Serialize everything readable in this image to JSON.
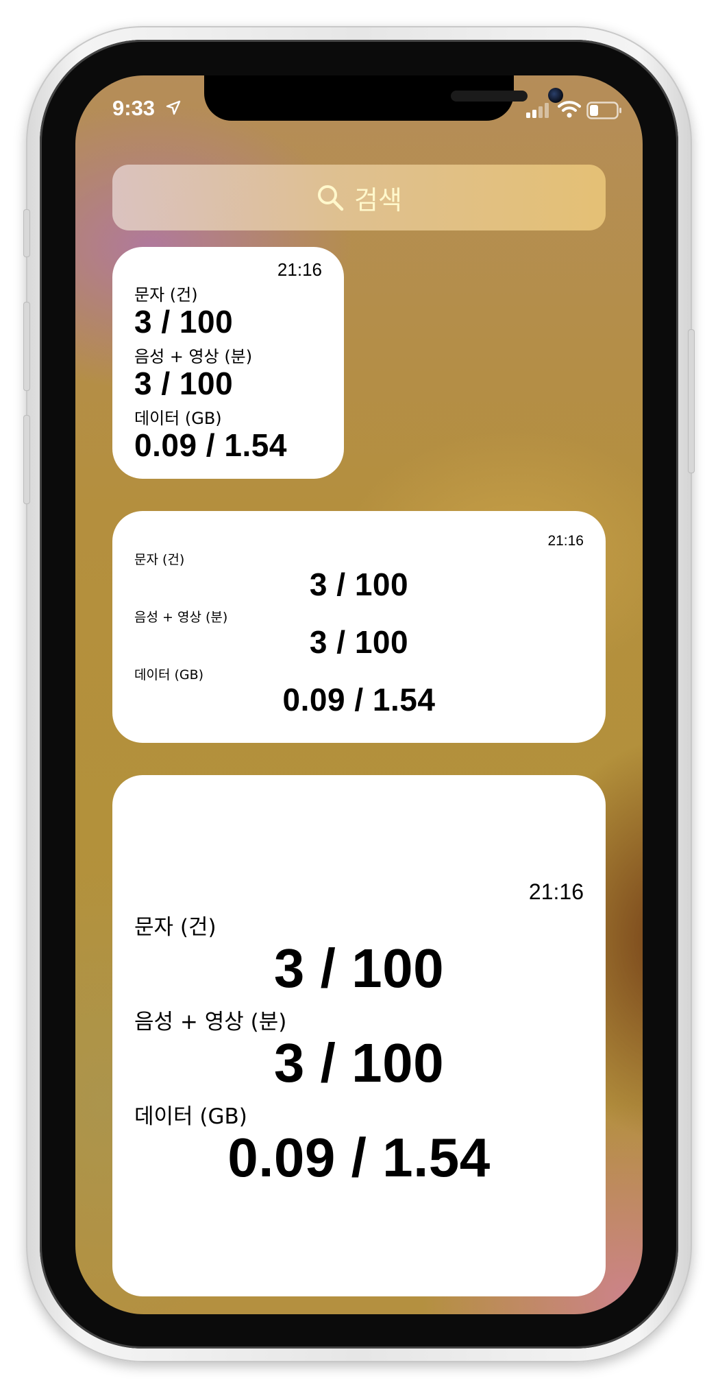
{
  "status_bar": {
    "time": "9:33",
    "icons": [
      "location-arrow-icon",
      "cellular-signal-icon",
      "wifi-icon",
      "battery-icon"
    ]
  },
  "search": {
    "label": "검색",
    "icon": "search-icon"
  },
  "widget_small": {
    "updated": "21:16",
    "sms_label": "문자 (건)",
    "sms_value": "3 / 100",
    "voice_label": "음성 + 영상 (분)",
    "voice_value": "3 / 100",
    "data_label": "데이터 (GB)",
    "data_value": "0.09 / 1.54"
  },
  "widget_medium": {
    "updated": "21:16",
    "sms_label": "문자 (건)",
    "sms_value": "3 / 100",
    "voice_label": "음성 + 영상 (분)",
    "voice_value": "3 / 100",
    "data_label": "데이터 (GB)",
    "data_value": "0.09 / 1.54"
  },
  "widget_large": {
    "updated": "21:16",
    "sms_label": "문자 (건)",
    "sms_value": "3 / 100",
    "voice_label": "음성 + 영상 (분)",
    "voice_value": "3 / 100",
    "data_label": "데이터 (GB)",
    "data_value": "0.09 / 1.54"
  },
  "colors": {
    "widget_bg": "#ffffff",
    "text": "#000000",
    "search_text": "#fff8cc"
  }
}
